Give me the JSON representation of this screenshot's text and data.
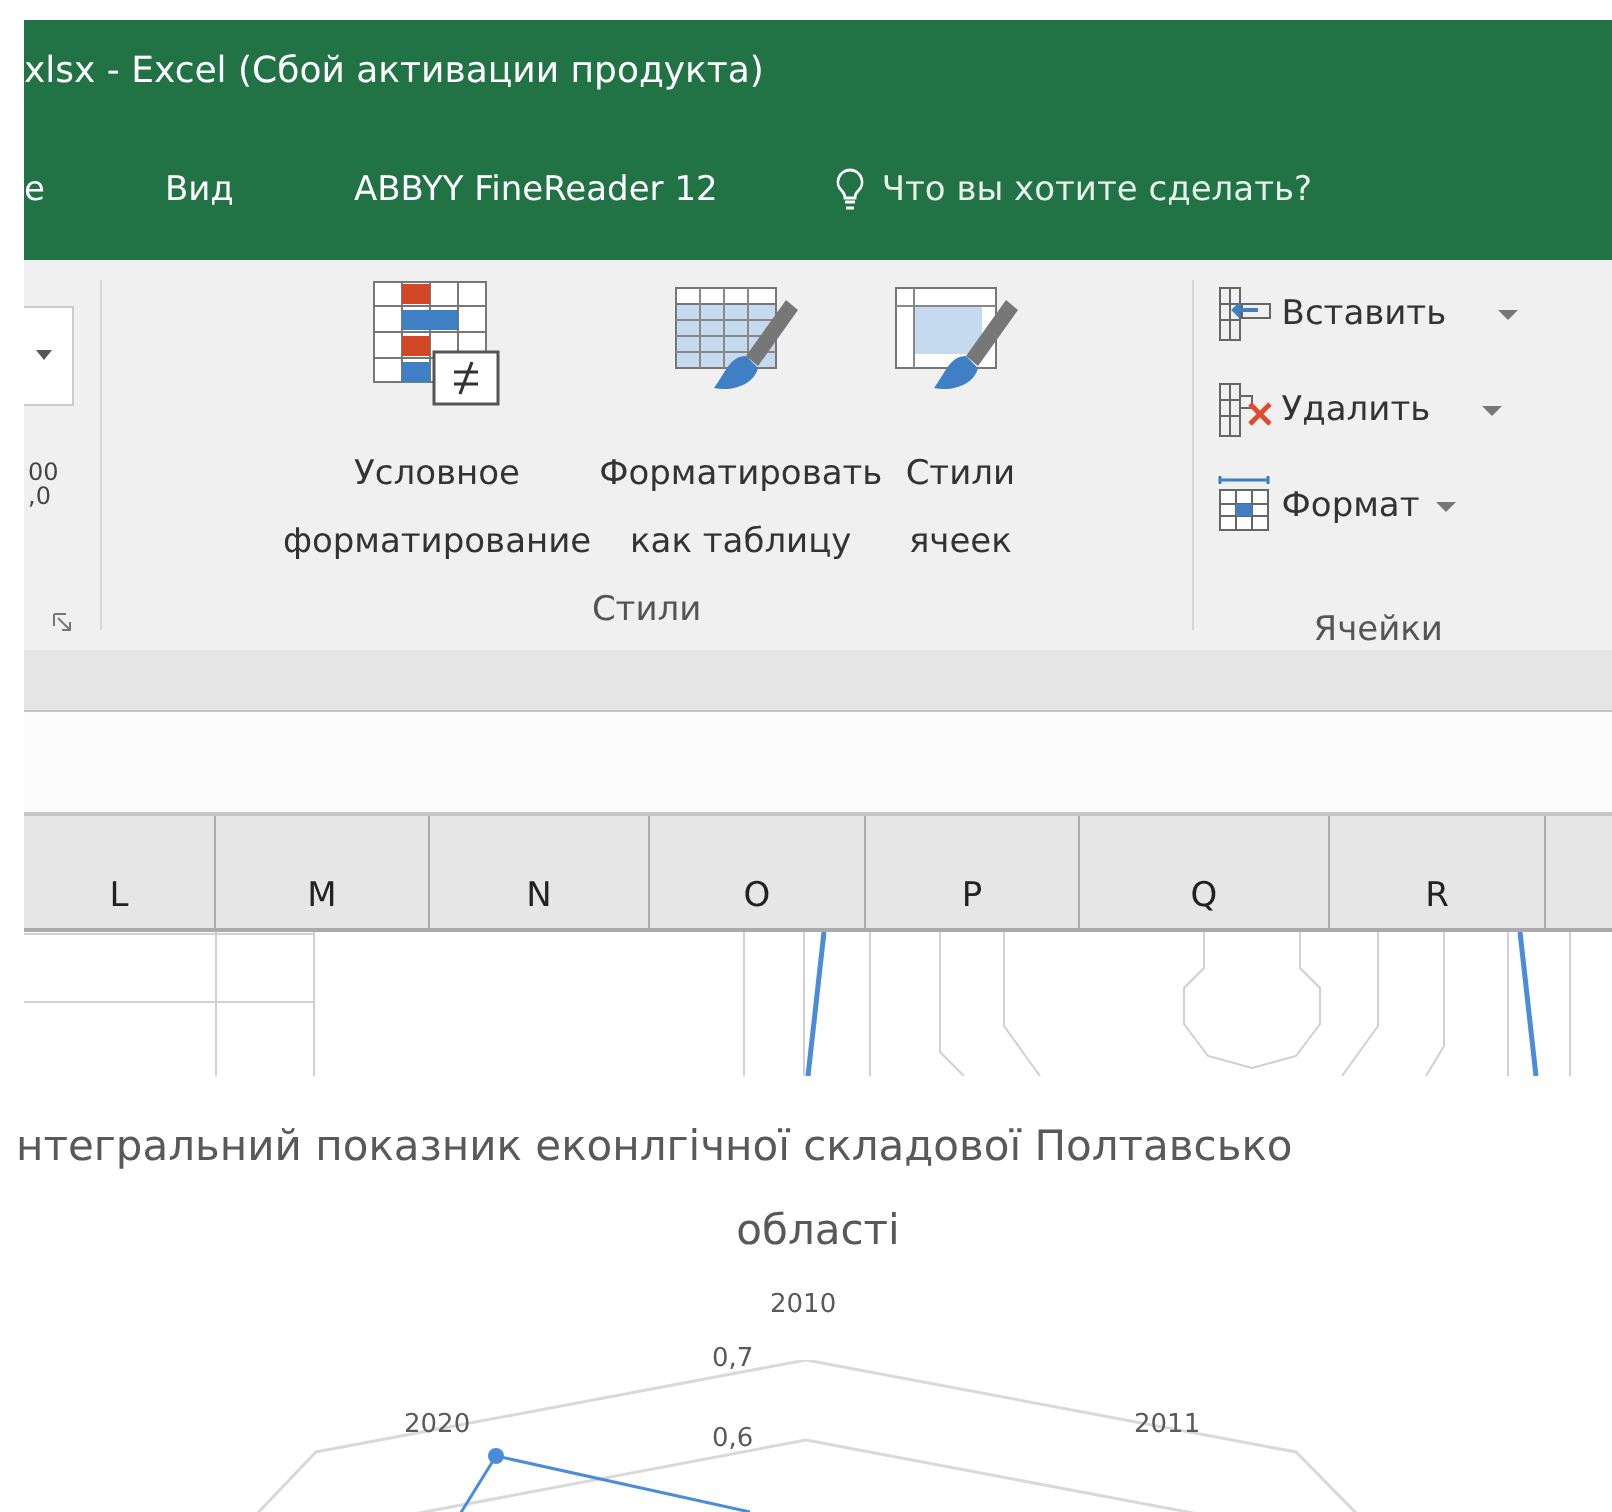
{
  "window": {
    "title": "xlsx - Excel (Сбой активации продукта)"
  },
  "tabs": [
    {
      "label": "e",
      "selected": false
    },
    {
      "label": "Вид",
      "selected": false
    },
    {
      "label": "ABBYY FineReader 12",
      "selected": false
    }
  ],
  "tell_me": {
    "placeholder": "Что вы хотите сделать?"
  },
  "ribbon": {
    "number_fragment": [
      "00",
      ",0"
    ],
    "styles_group": {
      "label": "Стили",
      "buttons": [
        {
          "kind": "conditional",
          "label": "Условное\nформатирование"
        },
        {
          "kind": "table",
          "label": "Форматировать\nкак таблицу"
        },
        {
          "kind": "cell",
          "label": "Стили\nячеек"
        }
      ]
    },
    "cells_group": {
      "label": "Ячейки",
      "buttons": [
        {
          "kind": "insert",
          "label": "Вставить"
        },
        {
          "kind": "delete",
          "label": "Удалить"
        },
        {
          "kind": "format",
          "label": "Формат"
        }
      ]
    }
  },
  "columns": [
    "L",
    "M",
    "N",
    "O",
    "P",
    "Q",
    "R"
  ],
  "chart": {
    "title_lines": [
      "нтегральний показник еконлгічної складової Полтавсько",
      "області"
    ],
    "axis_labels": [
      "2010",
      "2011",
      "2020"
    ],
    "ring_labels": [
      "0,7",
      "0,6"
    ]
  }
}
